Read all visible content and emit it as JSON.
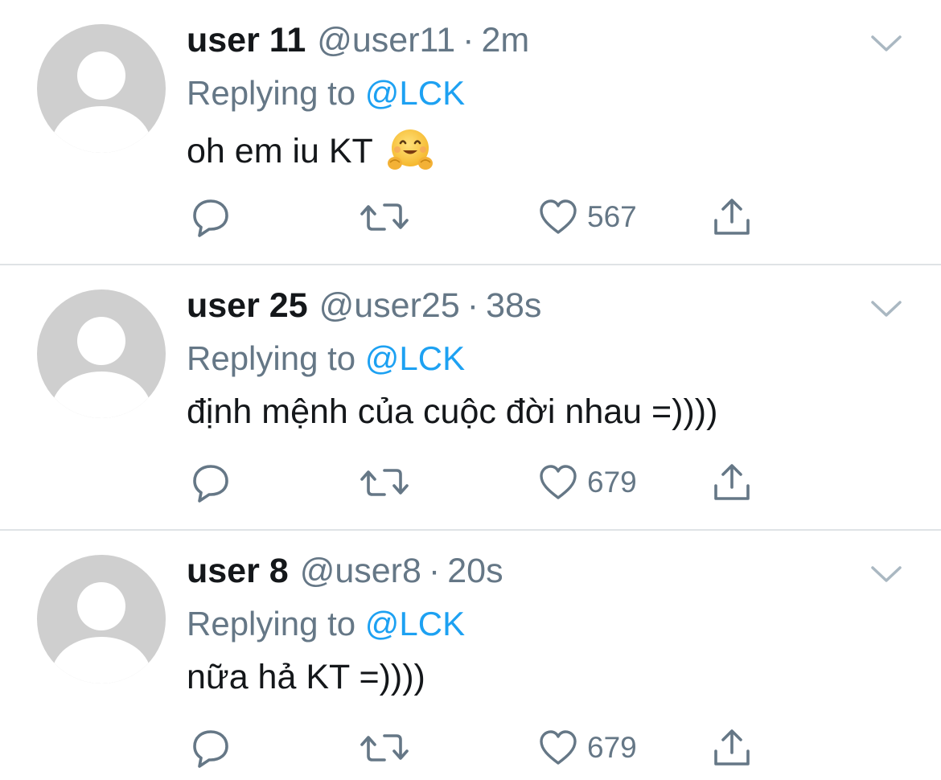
{
  "tweets": [
    {
      "name": "user 11",
      "handle": "@user11",
      "separator": "·",
      "time": "2m",
      "replying_prefix": "Replying to",
      "replying_to": "@LCK",
      "text": "oh em iu KT",
      "emoji": "hugging-face-emoji",
      "like_count": "567"
    },
    {
      "name": "user 25",
      "handle": "@user25",
      "separator": "·",
      "time": "38s",
      "replying_prefix": "Replying to",
      "replying_to": "@LCK",
      "text": "định mệnh của cuộc đời nhau =))))",
      "like_count": "679"
    },
    {
      "name": "user 8",
      "handle": "@user8",
      "separator": "·",
      "time": "20s",
      "replying_prefix": "Replying to",
      "replying_to": "@LCK",
      "text": "nữa hả KT =))))",
      "like_count": "679"
    }
  ],
  "icons": {
    "reply": "reply-icon",
    "retweet": "retweet-icon",
    "like": "heart-icon",
    "share": "share-icon",
    "more": "chevron-down-icon"
  },
  "colors": {
    "text": "#14171a",
    "secondary": "#657786",
    "link": "#1da1f2",
    "avatar": "#cfcfcf",
    "divider": "#dfe3e6"
  }
}
